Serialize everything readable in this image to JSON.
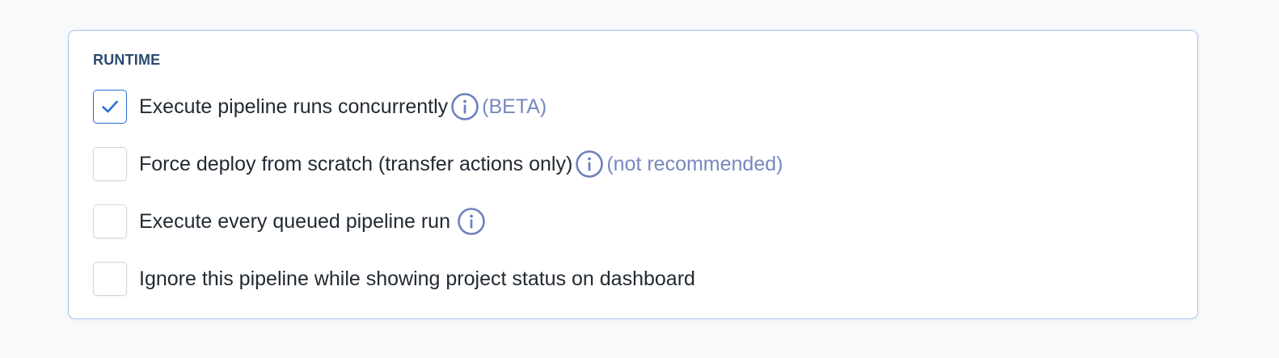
{
  "section": {
    "title": "RUNTIME"
  },
  "options": [
    {
      "label": "Execute pipeline runs concurrently",
      "checked": true,
      "note": "(BETA)",
      "icon": "info-circle-icon"
    },
    {
      "label": "Force deploy from scratch (transfer actions only)",
      "checked": false,
      "note": "(not recommended)",
      "icon": "info-circle-icon"
    },
    {
      "label": "Execute every queued pipeline run",
      "checked": false,
      "icon": "info-circle-icon"
    },
    {
      "label": "Ignore this pipeline while showing project status on dashboard",
      "checked": false
    }
  ],
  "colors": {
    "panel_border": "#a9c4ef",
    "check_accent": "#2f6fd6",
    "info_icon": "#6f80bd",
    "note_text": "#7888bf",
    "section_title": "#2a4a6e"
  }
}
